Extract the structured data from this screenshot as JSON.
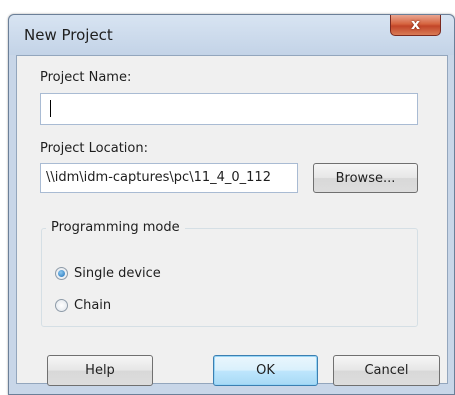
{
  "window": {
    "title": "New Project",
    "close_glyph": "x"
  },
  "project_name": {
    "label": "Project Name:",
    "value": ""
  },
  "project_location": {
    "label": "Project Location:",
    "value": "\\\\idm\\idm-captures\\pc\\11_4_0_112",
    "browse_label": "Browse..."
  },
  "programming_mode": {
    "legend": "Programming mode",
    "options": [
      {
        "label": "Single device",
        "selected": true
      },
      {
        "label": "Chain",
        "selected": false
      }
    ]
  },
  "buttons": {
    "help": "Help",
    "ok": "OK",
    "cancel": "Cancel"
  },
  "colors": {
    "title_bar": "#c8d6e8",
    "close_button": "#c9502f",
    "dialog_background": "#f0f0f0",
    "default_button": "#bee6fd"
  },
  "icons": {
    "close": "close-icon",
    "radio_selected": "radio-selected-icon",
    "radio_unselected": "radio-unselected-icon"
  }
}
